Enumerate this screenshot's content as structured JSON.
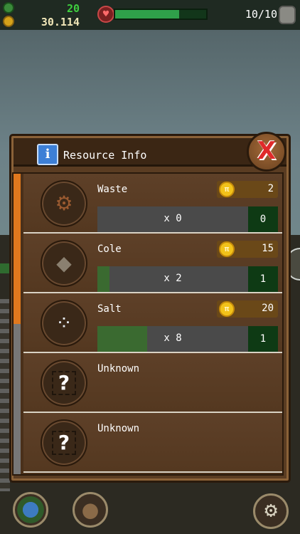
{
  "hud": {
    "resource_count": "20",
    "coins": "30.114",
    "health_fraction": 0.7,
    "capacity": "10/10"
  },
  "panel": {
    "title": "Resource Info",
    "info_icon_label": "i",
    "close_label": "X"
  },
  "scroll": {
    "thumb_fraction": 0.5
  },
  "resources": [
    {
      "name": "Waste",
      "icon": "waste-icon",
      "price": "2",
      "multiplier": "x 0",
      "owned": "0",
      "progress": 0.0
    },
    {
      "name": "Cole",
      "icon": "coal-icon",
      "price": "15",
      "multiplier": "x 2",
      "owned": "1",
      "progress": 0.08
    },
    {
      "name": "Salt",
      "icon": "salt-icon",
      "price": "20",
      "multiplier": "x 8",
      "owned": "1",
      "progress": 0.33
    },
    {
      "name": "Unknown",
      "icon": "question-icon"
    },
    {
      "name": "Unknown",
      "icon": "question-icon"
    }
  ],
  "unknown_symbol": "?",
  "coin_symbol": "π",
  "colors": {
    "accent_orange": "#e0781e",
    "coin_gold": "#f2c21a",
    "progress_green": "#3a6a30",
    "close_red": "#e02a2a"
  }
}
